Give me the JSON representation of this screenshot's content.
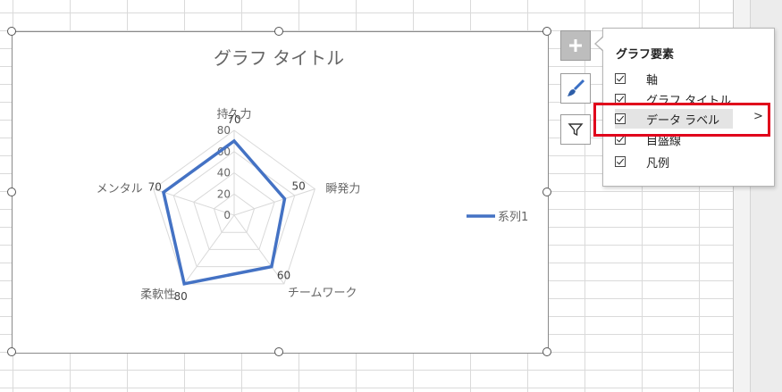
{
  "chart_data": {
    "type": "radar",
    "title": "グラフ タイトル",
    "axes": [
      "持久力",
      "瞬発力",
      "チームワーク",
      "柔軟性",
      "メンタル"
    ],
    "ticks": [
      "0",
      "20",
      "40",
      "60",
      "80"
    ],
    "rmax": 80,
    "series": [
      {
        "name": "系列1",
        "values": [
          70,
          50,
          60,
          80,
          70
        ],
        "color": "#4472c4"
      }
    ],
    "data_labels": [
      "70",
      "50",
      "60",
      "80",
      "70"
    ],
    "legend_position": "right"
  },
  "chart_tools": {
    "add_element_icon": "plus-icon",
    "styles_icon": "paintbrush-icon",
    "filter_icon": "funnel-icon"
  },
  "flyout": {
    "title": "グラフ要素",
    "items": [
      {
        "label": "軸",
        "checked": true
      },
      {
        "label": "グラフ タイトル",
        "checked": true
      },
      {
        "label": "データ ラベル",
        "checked": true,
        "highlighted": true,
        "has_submenu": true
      },
      {
        "label": "目盛線",
        "checked": true
      },
      {
        "label": "凡例",
        "checked": true
      }
    ],
    "submenu_glyph": ">"
  },
  "colors": {
    "series": "#4472c4",
    "highlight_box": "#e0001b"
  }
}
